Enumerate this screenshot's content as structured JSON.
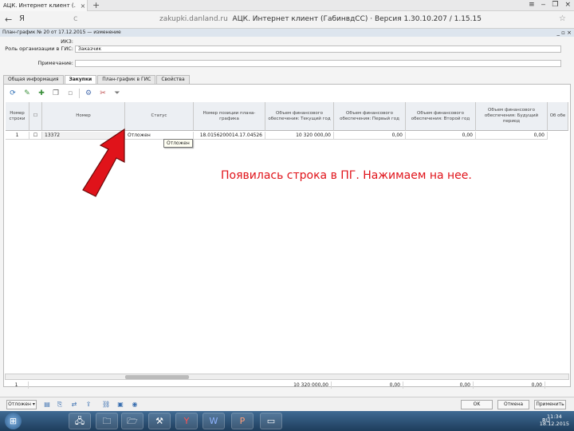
{
  "browser": {
    "tab_title": "АЦК. Интернет клиент (…",
    "tab_close": "×",
    "new_tab": "+",
    "controls": [
      "≡",
      "‒",
      "❐",
      "×"
    ],
    "back": "←",
    "logo": "Я",
    "reload": "c",
    "url_host": "zakupki.danland.ru",
    "url_title": "АЦК. Интернет клиент (ГабинвдСС) · Версия 1.30.10.207 / 1.15.15",
    "star": "☆"
  },
  "app": {
    "window_title": "План-график № 20 от 17.12.2015 — изменение",
    "window_controls": "_ ▫ ×",
    "form": {
      "label_1": "ИКЗ:",
      "label_2": "Роль организации в ГИС:",
      "value_2": "Заказчик",
      "label_3": "Примечание:"
    },
    "tabs": [
      {
        "label": "Общая информация",
        "active": false
      },
      {
        "label": "Закупки",
        "active": true
      },
      {
        "label": "План-график в ГИС",
        "active": false
      },
      {
        "label": "Свойства",
        "active": false
      }
    ],
    "toolbar_icons": [
      "refresh-icon",
      "edit-icon",
      "add-icon",
      "copy-icon",
      "delete-icon",
      "settings-icon",
      "tools-icon",
      "filter-icon"
    ],
    "grid": {
      "headers": [
        "Номер строки",
        "",
        "Номер",
        "Статус",
        "Номер позиции плана-графика",
        "Объем финансового обеспечения: Текущий год",
        "Объем финансового обеспечения: Первый год",
        "Объем финансового обеспечения: Второй год",
        "Объем финансового обеспечения: Будущий период",
        "Об обе"
      ],
      "row": {
        "num": "1",
        "number": "13372",
        "status": "Отложен",
        "position": "18.0156200014.17.04526",
        "cur_year": "10 320 000,00",
        "year1": "0,00",
        "year2": "0,00",
        "future": "0,00"
      },
      "tooltip": "Отложен",
      "totals": {
        "num": "1",
        "cur_year": "10 320 000,00",
        "year1": "0,00",
        "year2": "0,00",
        "future": "0,00"
      }
    },
    "bottom": {
      "select_label": "Отложен",
      "ok": "OK",
      "cancel": "Отмена",
      "apply": "Применить"
    }
  },
  "annotation": {
    "text": "Появилась строка в ПГ. Нажимаем на нее.",
    "color": "#e0131a"
  },
  "taskbar": {
    "tray_lang": "RU",
    "time": "11:34",
    "date": "18.12.2015"
  }
}
